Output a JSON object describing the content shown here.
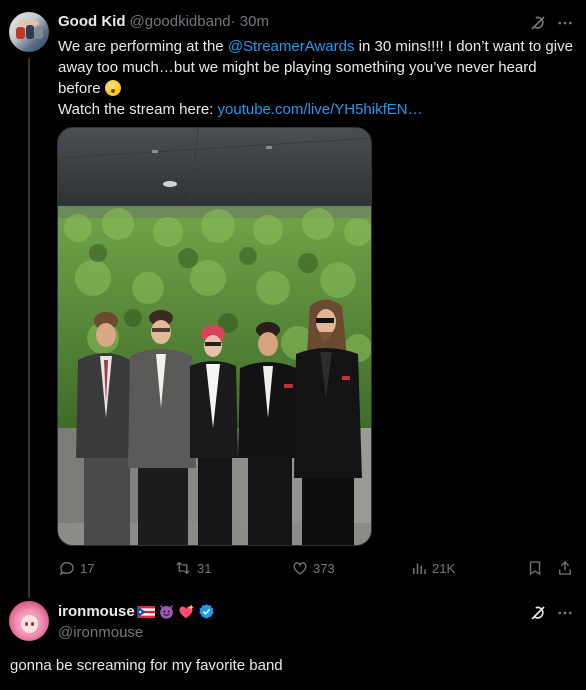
{
  "tweet": {
    "author_name": "Good Kid",
    "author_handle": "@goodkidband",
    "time": " · 30m",
    "text_line1_pre": "We are performing at the ",
    "mention": "@StreamerAwards",
    "text_line1_post": " in 30 mins!!!! I don’t want to give away too much…but we might be playing something you’ve never heard before ",
    "text_line2_pre": "Watch the stream here: ",
    "link": "youtube.com/live/YH5hikfEN…",
    "stats": {
      "replies": "17",
      "retweets": "31",
      "likes": "373",
      "views": "21K"
    }
  },
  "reply": {
    "author_name": "ironmouse",
    "author_handle": "@ironmouse",
    "text": "gonna be screaming for my favorite band"
  },
  "colors": {
    "background": "#000000",
    "text": "#e7e9ea",
    "muted": "#71767b",
    "link": "#1d9bf0",
    "verified": "#1d9bf0"
  }
}
